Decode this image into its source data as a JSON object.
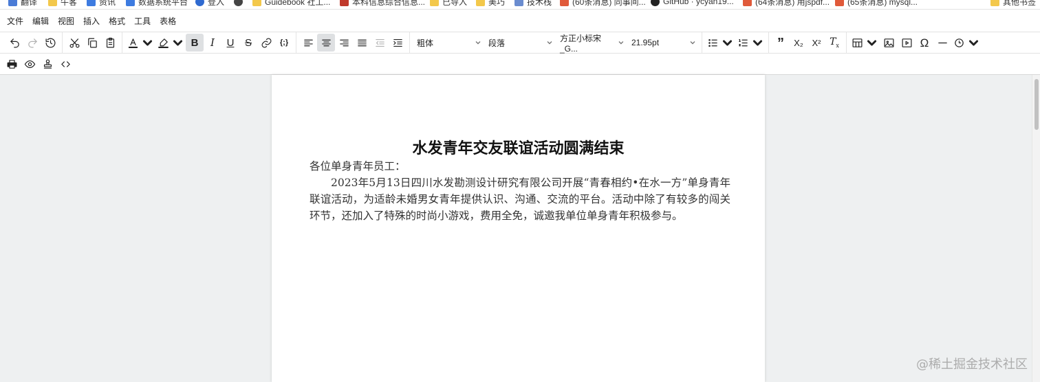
{
  "bookmarks": [
    "翻译",
    "牛客",
    "资讯",
    "数据系统平台",
    "登入",
    "",
    "Guidebook 社工...",
    "本科信息综合信息...",
    "已导入",
    "美巧",
    "技术栈",
    "(60条消息) 同事间...",
    "GitHub · ycyan19...",
    "(64条消息) 用jspdf...",
    "(65条消息) mysql...",
    "其他书签"
  ],
  "menubar": [
    "文件",
    "编辑",
    "视图",
    "插入",
    "格式",
    "工具",
    "表格"
  ],
  "toolbar": {
    "font_weight": "粗体",
    "block_format": "段落",
    "font_family": "方正小标宋_G...",
    "font_size": "21.95pt",
    "code_label": "{;}",
    "subscript": "X₂",
    "superscript": "X²"
  },
  "document": {
    "title": "水发青年交友联谊活动圆满结束",
    "salutation": "各位单身青年员工：",
    "paragraph": "2023年5月13日四川水发勘测设计研究有限公司开展“青春相约•在水一方”单身青年联谊活动，为适龄未婚男女青年提供认识、沟通、交流的平台。活动中除了有较多的闯关环节，还加入了特殊的时尚小游戏，费用全免，诚邀我单位单身青年积极参与。"
  },
  "watermark": "@稀土掘金技术社区",
  "colors": {
    "active_button": "#dee0e2",
    "page_background": "#eef0f1",
    "text_color_bar": "#222222",
    "highlight_bar": "#222222"
  }
}
